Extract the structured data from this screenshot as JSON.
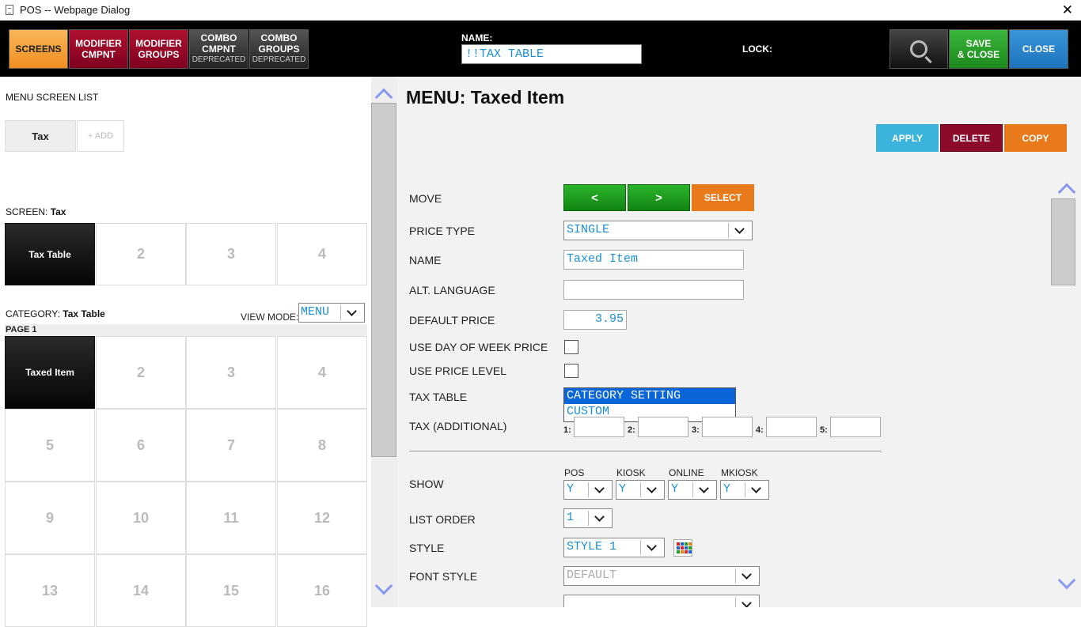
{
  "window": {
    "title": "POS -- Webpage Dialog",
    "close_glyph": "✕"
  },
  "toolbar": {
    "screens": "SCREENS",
    "modifier_cmpnt": [
      "MODIFIER",
      "CMPNT"
    ],
    "modifier_groups": [
      "MODIFIER",
      "GROUPS"
    ],
    "combo_cmpnt": [
      "COMBO",
      "CMPNT",
      "DEPRECATED"
    ],
    "combo_groups": [
      "COMBO",
      "GROUPS",
      "DEPRECATED"
    ],
    "name_label": "NAME:",
    "name_value": "!!TAX TABLE",
    "lock_label": "LOCK:",
    "save_close": [
      "SAVE",
      "& CLOSE"
    ],
    "close": "CLOSE"
  },
  "left": {
    "menu_screen_list_label": "MENU SCREEN LIST",
    "screen_tabs": [
      "Tax"
    ],
    "add_label": "+ ADD",
    "screen_label": "SCREEN:",
    "screen_name": "Tax",
    "screen_cells": [
      "Tax Table",
      "2",
      "3",
      "4"
    ],
    "category_label": "CATEGORY:",
    "category_name": "Tax Table",
    "view_mode_label": "VIEW MODE:",
    "view_mode_value": "MENU",
    "page_label": "PAGE 1",
    "item_cells": [
      "Taxed Item",
      "2",
      "3",
      "4",
      "5",
      "6",
      "7",
      "8",
      "9",
      "10",
      "11",
      "12",
      "13",
      "14",
      "15",
      "16"
    ]
  },
  "right": {
    "title": "MENU: Taxed Item",
    "apply": "APPLY",
    "delete": "DELETE",
    "copy": "COPY",
    "move_label": "MOVE",
    "move_prev": "<",
    "move_next": ">",
    "select": "SELECT",
    "price_type_label": "PRICE TYPE",
    "price_type_value": "SINGLE",
    "name_label": "NAME",
    "name_value": "Taxed Item",
    "alt_language_label": "ALT. LANGUAGE",
    "alt_language_value": "",
    "default_price_label": "DEFAULT PRICE",
    "default_price_value": "3.95",
    "use_dow_price_label": "USE DAY OF WEEK PRICE",
    "use_price_level_label": "USE PRICE LEVEL",
    "tax_table_label": "TAX TABLE",
    "tax_table_options": [
      "CATEGORY SETTING",
      "CUSTOM"
    ],
    "tax_additional_label": "TAX (ADDITIONAL)",
    "tax_additional_slots": [
      "1:",
      "2:",
      "3:",
      "4:",
      "5:"
    ],
    "show_label": "SHOW",
    "show_columns": [
      "POS",
      "KIOSK",
      "ONLINE",
      "MKIOSK"
    ],
    "show_values": [
      "Y",
      "Y",
      "Y",
      "Y"
    ],
    "list_order_label": "LIST ORDER",
    "list_order_value": "1",
    "style_label": "STYLE",
    "style_value": "STYLE 1",
    "font_style_label": "FONT STYLE",
    "font_style_value": "DEFAULT"
  },
  "colors": {
    "screens_orange": "#f08e1f",
    "modifier_red": "#800020",
    "save_green": "#1c8a1c",
    "close_blue": "#1d74bd",
    "value_blue": "#1a8fd6",
    "selection_blue": "#0a66d8"
  },
  "icons": {
    "search": "magnifier-icon",
    "scroll_up": "chevron-up-icon",
    "scroll_down": "chevron-down-icon",
    "style_palette": "color-grid-icon"
  }
}
